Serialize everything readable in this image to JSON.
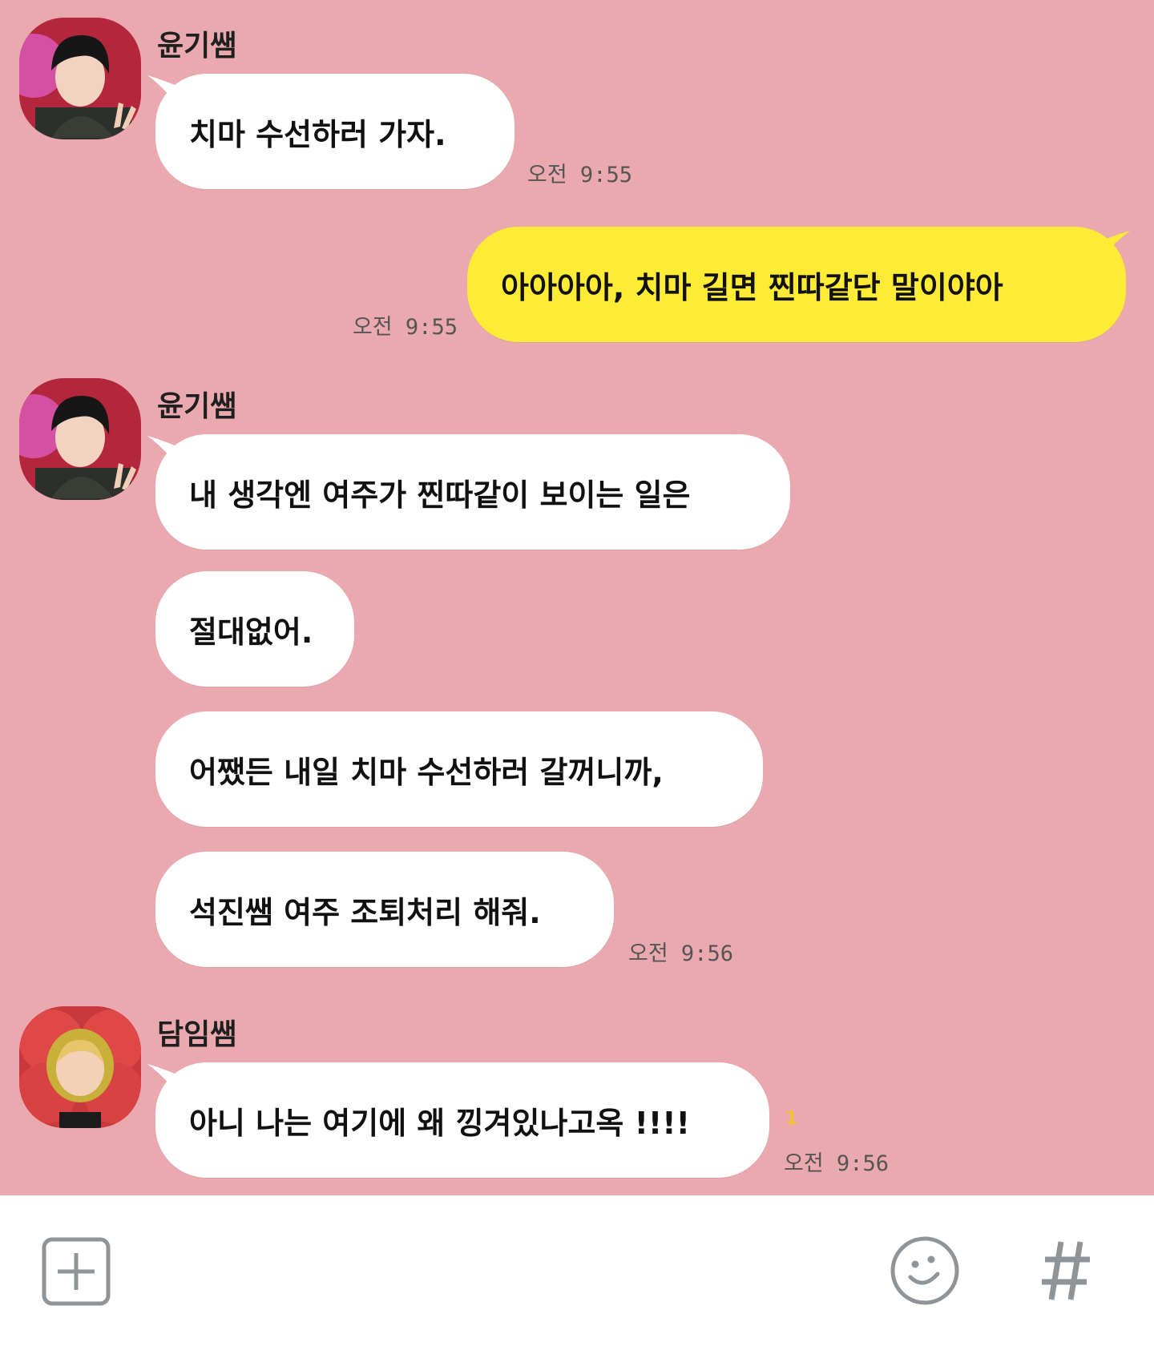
{
  "chat": {
    "background_color": "#e9a9ae",
    "my_bubble_color": "#fdeb35",
    "other_bubble_color": "#ffffff",
    "groups": [
      {
        "sender": "윤기쌤",
        "avatar": "avatar-photo-icon",
        "messages": [
          "치마 수선하러 가자."
        ],
        "time": "오전 9:55"
      },
      {
        "sender": "me",
        "messages": [
          "아아아아, 치마 길면 찐따같단 말이야아"
        ],
        "time": "오전 9:55"
      },
      {
        "sender": "윤기쌤",
        "avatar": "avatar-photo-icon",
        "messages": [
          "내 생각엔 여주가 찐따같이 보이는 일은",
          "절대없어.",
          "어쨌든 내일 치마 수선하러 갈꺼니까,",
          "석진쌤 여주 조퇴처리 해줘."
        ],
        "time": "오전 9:56"
      },
      {
        "sender": "담임쌤",
        "avatar": "avatar-flower-costume-icon",
        "messages": [
          "아니 나는 여기에 왜 낑겨있나고옥 !!!!"
        ],
        "time": "오전 9:56",
        "unread": "1"
      }
    ]
  },
  "input_bar": {
    "add_button": "plus-square-icon",
    "emoji_button": "smiley-icon",
    "hashtag_button": "hashtag-icon"
  }
}
